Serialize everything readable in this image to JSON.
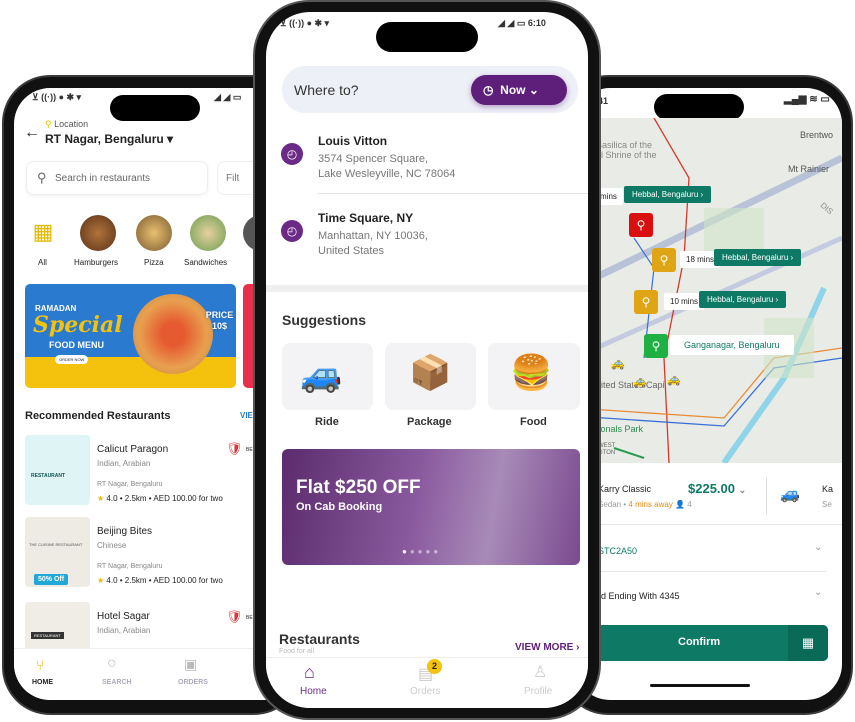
{
  "food_app": {
    "location_label": "Location",
    "location": "RT Nagar, Bengaluru",
    "search_placeholder": "Search in restaurants",
    "filter_label": "Filt",
    "categories": [
      {
        "label": "All"
      },
      {
        "label": "Hamburgers"
      },
      {
        "label": "Pizza"
      },
      {
        "label": "Sandwiches"
      }
    ],
    "banner": {
      "line1": "RAMADAN",
      "line2": "Special",
      "line3": "FOOD MENU",
      "cta": "ORDER NOW",
      "price": "PRICE 10$"
    },
    "section_title": "Recommended Restaurants",
    "view_all": "VIE",
    "restaurants": [
      {
        "name": "Calicut Paragon",
        "cuisine": "Indian, Arabian",
        "location": "RT Nagar, Bengaluru",
        "rating": "4.0",
        "distance": "2.5km",
        "price": "AED 100.00 for two",
        "badge": "BE",
        "logo": "RESTAURANT"
      },
      {
        "name": "Beijing Bites",
        "cuisine": "Chinese",
        "location": "RT Nagar, Bengaluru",
        "rating": "4.0",
        "distance": "2.5km",
        "price": "AED 100.00 for two",
        "offer": "50% Off",
        "logo": "THE CUISINE RESTAURANT"
      },
      {
        "name": "Hotel Sagar",
        "cuisine": "Indian, Arabian",
        "badge": "BE",
        "logo": "RESTAURANT"
      }
    ],
    "nav": [
      "HOME",
      "SEARCH",
      "ORDERS"
    ]
  },
  "ride_app": {
    "time": "6:10",
    "where_to": "Where to?",
    "now_label": "Now",
    "recent": [
      {
        "title": "Louis Vitton",
        "line1": "3574 Spencer Square,",
        "line2": "Lake Wesleyville, NC 78064"
      },
      {
        "title": "Time Square, NY",
        "line1": "Manhattan, NY 10036,",
        "line2": "United States"
      }
    ],
    "suggestions_title": "Suggestions",
    "suggestions": [
      {
        "label": "Ride"
      },
      {
        "label": "Package"
      },
      {
        "label": "Food"
      }
    ],
    "promo": {
      "title": "Flat $250 OFF",
      "subtitle": "On Cab Booking",
      "slides": 5,
      "active_slide": 1
    },
    "restaurants_title": "Restaurants",
    "restaurants_sub": "Food for all",
    "view_more": "VIEW MORE",
    "nav": [
      {
        "label": "Home"
      },
      {
        "label": "Orders",
        "badge": "2"
      },
      {
        "label": "Profile"
      }
    ],
    "accent": "#5e1f7a"
  },
  "map_app": {
    "time": "41",
    "map_labels": [
      "Basilica of the",
      "al Shrine of the",
      "Brentwo",
      "Mt Rainier",
      "nited States Capi",
      "tionals Park",
      "WEST",
      "GTON",
      "DIS"
    ],
    "stops": [
      {
        "eta": "mins",
        "name": "Hebbal, Bengaluru",
        "color": "#d90f0f"
      },
      {
        "eta": "18 mins",
        "name": "Hebbal, Bengaluru",
        "color": "#e0a514"
      },
      {
        "eta": "10 mins",
        "name": "Hebbal, Bengaluru",
        "color": "#e0a514"
      },
      {
        "name": "Ganganagar, Bengaluru",
        "color": "#1fb043"
      }
    ],
    "vehicle": {
      "name": "Karry Classic",
      "price": "$225.00",
      "type": "Sedan",
      "eta": "4 mins away",
      "seats": "4"
    },
    "vehicle2": {
      "name": "Ka",
      "type": "Se"
    },
    "promo_code": "STC2A50",
    "payment": "rd Ending With 4345",
    "confirm": "Confirm",
    "accent": "#0e7a66"
  }
}
